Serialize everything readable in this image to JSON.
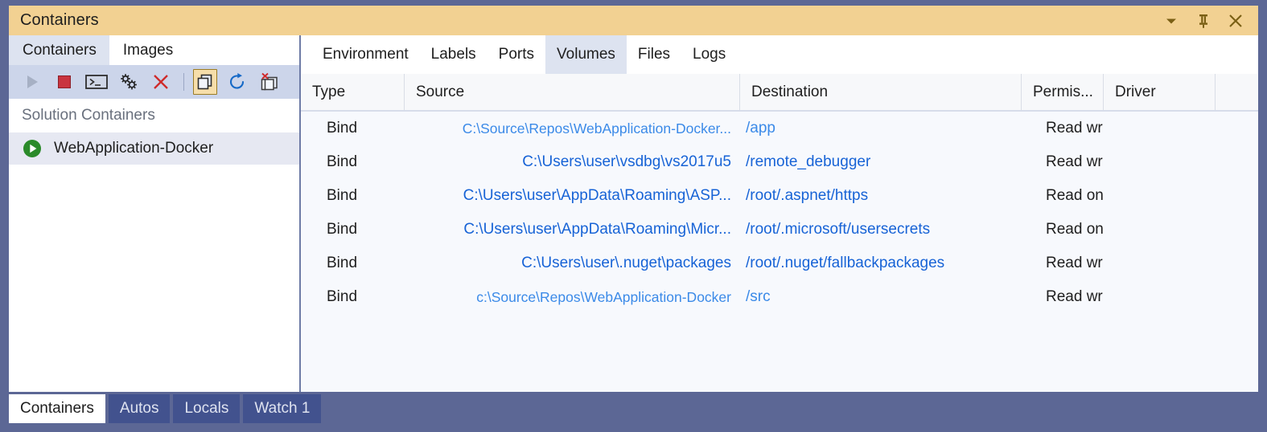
{
  "window": {
    "title": "Containers",
    "title_bar_color": "#f2d192",
    "frame_color": "#5c6795",
    "buttons": [
      {
        "name": "window-dropdown-button",
        "icon": "chevron-down-icon"
      },
      {
        "name": "window-pin-button",
        "icon": "pin-icon"
      },
      {
        "name": "window-close-button",
        "icon": "close-icon"
      }
    ]
  },
  "left_panel": {
    "tabs": [
      {
        "label": "Containers",
        "active": true
      },
      {
        "label": "Images",
        "active": false
      }
    ],
    "toolbar": [
      {
        "name": "start-container-button",
        "icon": "play-icon",
        "state": "disabled",
        "color": "#a6b0c4"
      },
      {
        "name": "stop-container-button",
        "icon": "stop-square-icon",
        "state": "enabled",
        "color": "#c9343f"
      },
      {
        "name": "open-terminal-button",
        "icon": "terminal-icon",
        "state": "enabled",
        "color": "#3a3a3a"
      },
      {
        "name": "container-settings-button",
        "icon": "gears-icon",
        "state": "enabled",
        "color": "#1e1e1e"
      },
      {
        "name": "remove-container-button",
        "icon": "red-x-icon",
        "state": "enabled",
        "color": "#cf2a2a"
      },
      {
        "name": "toolbar-separator",
        "icon": "separator",
        "state": "static",
        "color": "#9aa6c4"
      },
      {
        "name": "show-containers-button",
        "icon": "copy-pages-icon",
        "state": "pressed",
        "color": "#3a3a3a"
      },
      {
        "name": "refresh-button",
        "icon": "refresh-circle-icon",
        "state": "enabled",
        "color": "#1569c7"
      },
      {
        "name": "prune-containers-button",
        "icon": "remove-pages-icon",
        "state": "enabled",
        "color": "#3a3a3a"
      }
    ],
    "section_header": "Solution Containers",
    "containers": [
      {
        "name": "WebApplication-Docker",
        "status_icon": "running-play-icon",
        "status_color": "#2a8a2a",
        "selected": true
      }
    ]
  },
  "right_panel": {
    "tabs": [
      {
        "label": "Environment",
        "active": false
      },
      {
        "label": "Labels",
        "active": false
      },
      {
        "label": "Ports",
        "active": false
      },
      {
        "label": "Volumes",
        "active": true
      },
      {
        "label": "Files",
        "active": false
      },
      {
        "label": "Logs",
        "active": false
      }
    ],
    "table": {
      "columns": [
        "Type",
        "Source",
        "Destination",
        "Permis...",
        "Driver",
        ""
      ],
      "rows": [
        {
          "type": "Bind",
          "source": "C:\\Source\\Repos\\WebApplication-Docker...",
          "destination": "/app",
          "permissions": "Read write",
          "driver": "",
          "dim": true
        },
        {
          "type": "Bind",
          "source": "C:\\Users\\user\\vsdbg\\vs2017u5",
          "destination": "/remote_debugger",
          "permissions": "Read write",
          "driver": "",
          "dim": false
        },
        {
          "type": "Bind",
          "source": "C:\\Users\\user\\AppData\\Roaming\\ASP...",
          "destination": "/root/.aspnet/https",
          "permissions": "Read only",
          "driver": "",
          "dim": false
        },
        {
          "type": "Bind",
          "source": "C:\\Users\\user\\AppData\\Roaming\\Micr...",
          "destination": "/root/.microsoft/usersecrets",
          "permissions": "Read only",
          "driver": "",
          "dim": false
        },
        {
          "type": "Bind",
          "source": "C:\\Users\\user\\.nuget\\packages",
          "destination": "/root/.nuget/fallbackpackages",
          "permissions": "Read write",
          "driver": "",
          "dim": false
        },
        {
          "type": "Bind",
          "source": "c:\\Source\\Repos\\WebApplication-Docker",
          "destination": "/src",
          "permissions": "Read write",
          "driver": "",
          "dim": true
        }
      ]
    }
  },
  "bottom_tabs": [
    {
      "label": "Containers",
      "active": true
    },
    {
      "label": "Autos",
      "active": false
    },
    {
      "label": "Locals",
      "active": false
    },
    {
      "label": "Watch 1",
      "active": false
    }
  ]
}
